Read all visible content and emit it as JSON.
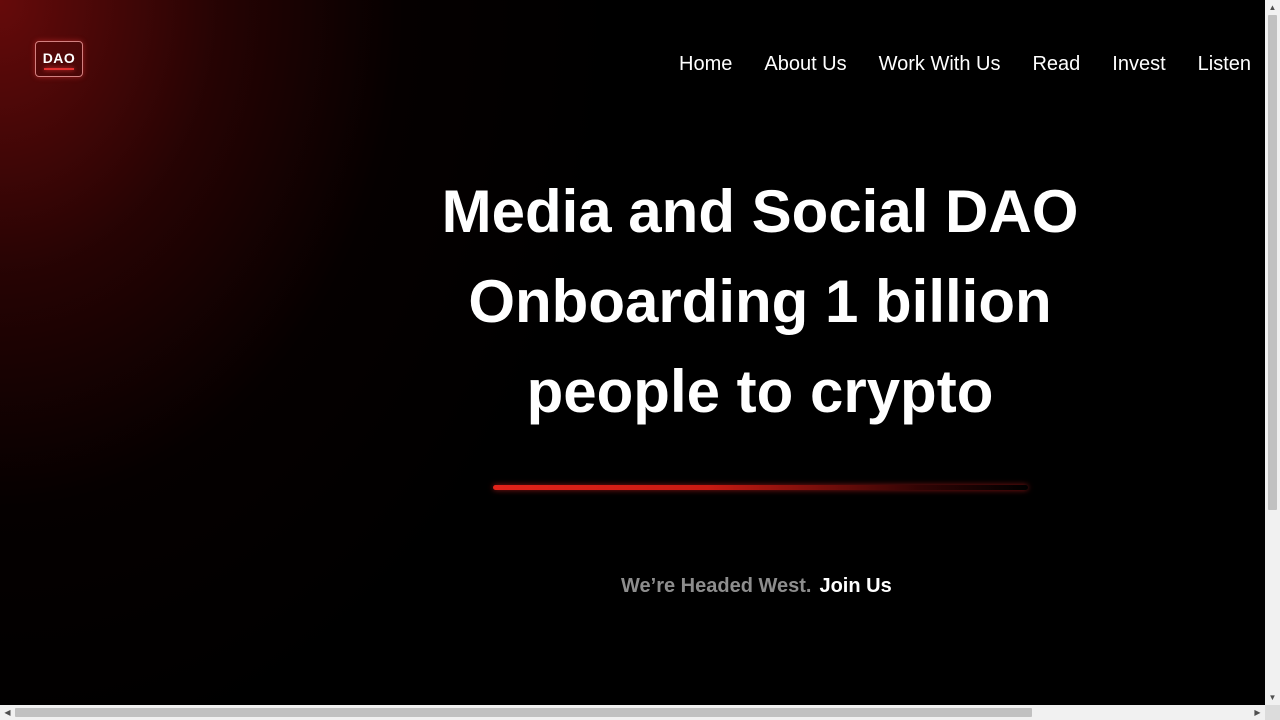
{
  "header": {
    "logo_text": "DAO",
    "nav": [
      {
        "label": "Home"
      },
      {
        "label": "About Us"
      },
      {
        "label": "Work With Us"
      },
      {
        "label": "Read"
      },
      {
        "label": "Invest"
      },
      {
        "label": "Listen"
      }
    ]
  },
  "hero": {
    "title_lines": [
      "Media and Social DAO",
      "Onboarding 1 billion",
      "people to crypto"
    ],
    "tagline_muted": "We’re Headed West.",
    "tagline_cta": "Join Us"
  },
  "colors": {
    "accent_red": "#e2231a",
    "background": "#000000",
    "muted_text": "#8d8d8d"
  },
  "scrollbars": {
    "vertical_arrow_up": "▲",
    "vertical_arrow_down": "▼",
    "horizontal_arrow_left": "◀",
    "horizontal_arrow_right": "▶"
  }
}
